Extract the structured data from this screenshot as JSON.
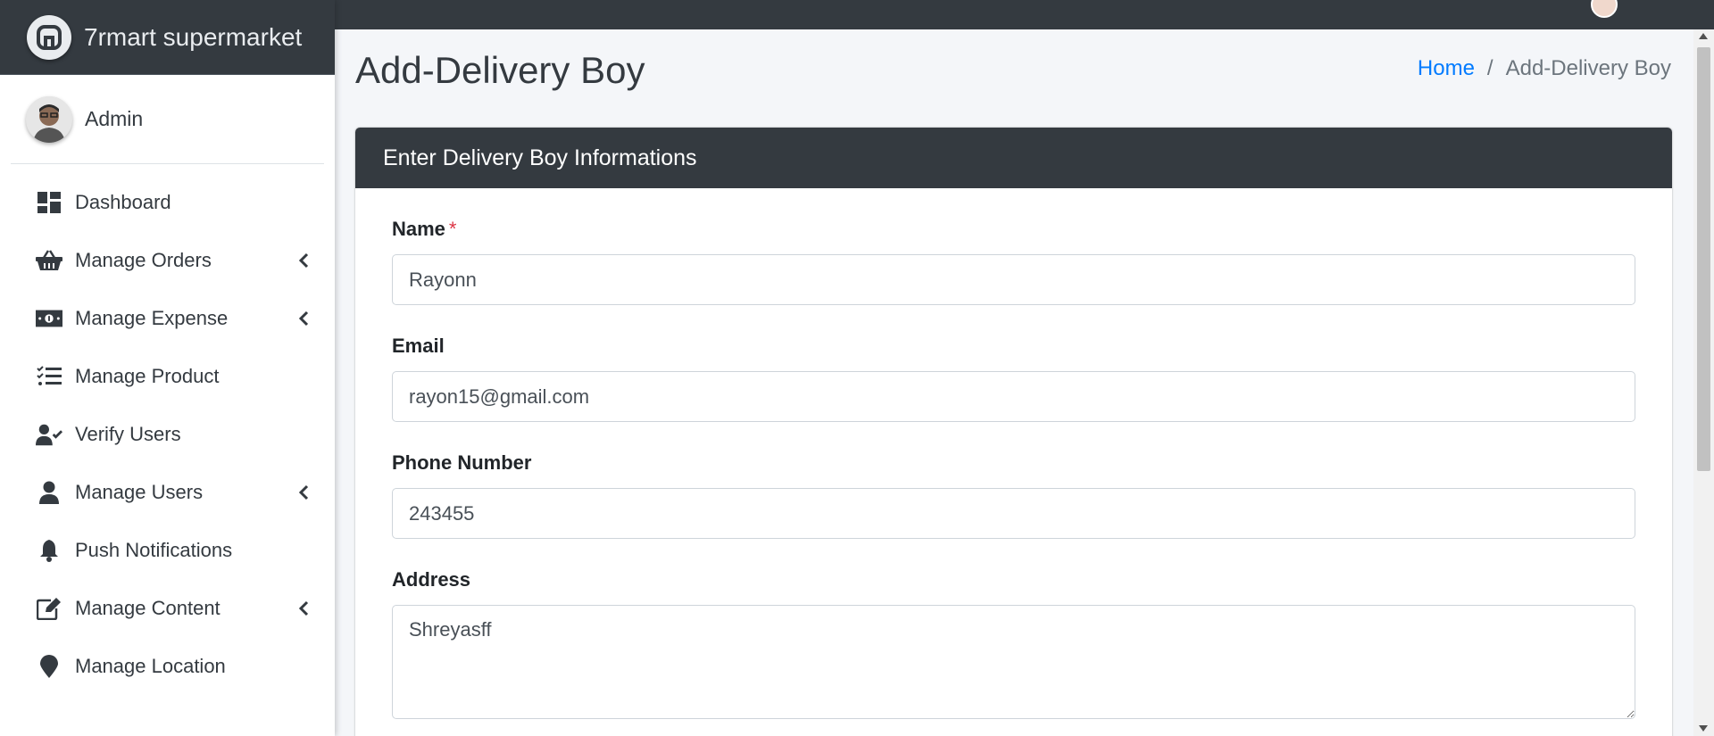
{
  "brand": {
    "name": "7rmart supermarket"
  },
  "user": {
    "name": "Admin"
  },
  "sidebar": {
    "items": [
      {
        "label": "Dashboard",
        "icon": "dashboard-icon",
        "has_submenu": false
      },
      {
        "label": "Manage Orders",
        "icon": "basket-icon",
        "has_submenu": true
      },
      {
        "label": "Manage Expense",
        "icon": "money-bill-icon",
        "has_submenu": true
      },
      {
        "label": "Manage Product",
        "icon": "tasks-list-icon",
        "has_submenu": false
      },
      {
        "label": "Verify Users",
        "icon": "user-check-icon",
        "has_submenu": false
      },
      {
        "label": "Manage Users",
        "icon": "user-icon",
        "has_submenu": true
      },
      {
        "label": "Push Notifications",
        "icon": "bell-icon",
        "has_submenu": false
      },
      {
        "label": "Manage Content",
        "icon": "edit-icon",
        "has_submenu": true
      },
      {
        "label": "Manage Location",
        "icon": "map-marker-icon",
        "has_submenu": false
      }
    ]
  },
  "page": {
    "title": "Add-Delivery Boy"
  },
  "breadcrumb": {
    "home": "Home",
    "separator": "/",
    "current": "Add-Delivery Boy"
  },
  "card": {
    "title": "Enter Delivery Boy Informations"
  },
  "form": {
    "name": {
      "label": "Name",
      "required_mark": "*",
      "value": "Rayonn"
    },
    "email": {
      "label": "Email",
      "value": "rayon15@gmail.com"
    },
    "phone": {
      "label": "Phone Number",
      "value": "243455"
    },
    "address": {
      "label": "Address",
      "value": "Shreyasff"
    }
  },
  "colors": {
    "sidebar_dark": "#343a40",
    "link": "#007bff",
    "required": "#dc3545",
    "background": "#f4f6f9"
  }
}
